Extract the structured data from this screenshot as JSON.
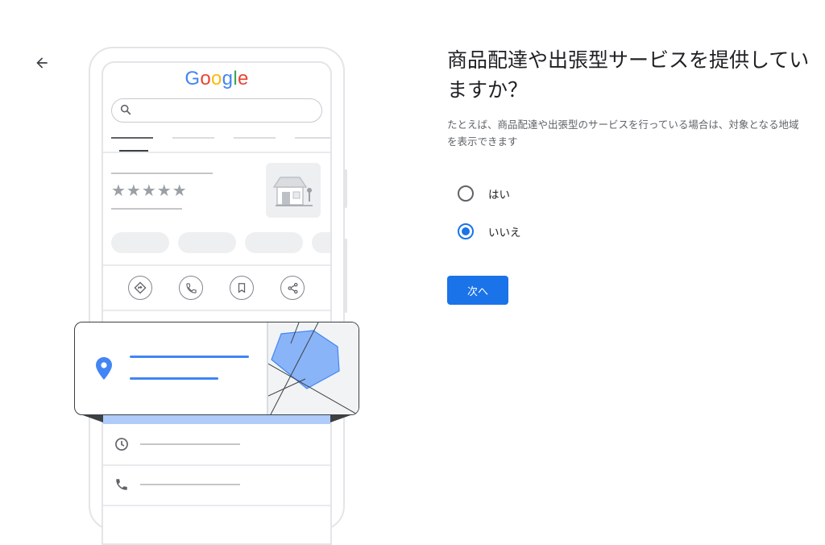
{
  "nav": {
    "back_icon": "arrow-back-icon"
  },
  "illustration": {
    "brand_letters": [
      {
        "ch": "G",
        "color": "#4285F4"
      },
      {
        "ch": "o",
        "color": "#EA4335"
      },
      {
        "ch": "o",
        "color": "#FBBC05"
      },
      {
        "ch": "g",
        "color": "#4285F4"
      },
      {
        "ch": "l",
        "color": "#34A853"
      },
      {
        "ch": "e",
        "color": "#EA4335"
      }
    ],
    "stars": "★★★★★",
    "accent": "#4285F4",
    "area_fill": "#8ab4f8"
  },
  "question": {
    "title": "商品配達や出張型サービスを提供していますか？",
    "description": "たとえば、商品配達や出張型のサービスを行っている場合は、対象となる地域を表示できます"
  },
  "options": [
    {
      "label": "はい",
      "checked": false
    },
    {
      "label": "いいえ",
      "checked": true
    }
  ],
  "actions": {
    "next_label": "次へ"
  },
  "colors": {
    "primary": "#1a73e8",
    "text": "#202124",
    "secondary_text": "#5f6368"
  }
}
